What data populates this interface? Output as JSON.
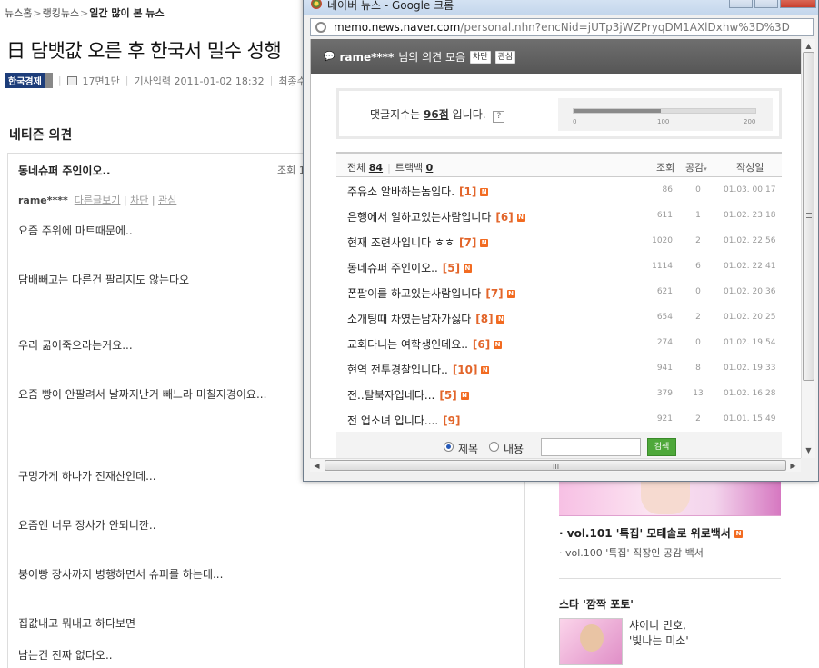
{
  "article": {
    "breadcrumb": [
      "뉴스홈",
      "랭킹뉴스",
      "일간 많이 본 뉴스"
    ],
    "headline": "日 담뱃값 오른 후 한국서 밀수 성행",
    "press": "한국경제",
    "page": "17면1단",
    "published": "기사입력 2011-01-02 18:32",
    "updated": "최종수정"
  },
  "comments": {
    "section_title": "네티즌 의견",
    "title": "동네슈퍼 주인이오..",
    "views_label": "조회 1",
    "user": "rame****",
    "actions": [
      "다른글보기",
      "차단",
      "관심"
    ],
    "lines": [
      "요즘 주위에 마트때문에..",
      "담배빼고는 다른건 팔리지도 않는다오",
      "우리 굶어죽으라는거요...",
      "요즘 빵이 안팔려서 날짜지난거 빼느라 미칠지경이요...",
      "구멍가게 하나가 전재산인데...",
      "요즘엔 너무 장사가 안되니깐..",
      "붕어빵 장사까지 병행하면서 슈퍼를 하는데...",
      "집값내고 뭐내고 하다보면",
      "남는건 진짜 없다오.."
    ]
  },
  "sidebar": {
    "item1": "vol.101 '특집' 모태솔로 위로백서",
    "item2": "vol.100 '특집' 직장인 공감 백서",
    "star_title": "스타 '깜짝 포토'",
    "star_caption": [
      "샤이니 민호,",
      "'빛나는 미소'"
    ]
  },
  "popup": {
    "window_title": "네이버 뉴스 - Google 크롬",
    "url_host": "memo.news.naver.com",
    "url_path": "/personal.nhn?encNid=jUTp3jWZPryqDM1AXlDxhw%3D%3D",
    "memo_user": "rame****",
    "memo_title_suffix": "님의 의견 모음",
    "tag_block": "차단",
    "tag_follow": "관심",
    "score_prefix": "댓글지수는",
    "score_value": "96점",
    "score_suffix": "입니다.",
    "help": "?",
    "gauge": {
      "fraction": 0.48,
      "ticks": [
        "0",
        "100",
        "200"
      ]
    },
    "tab_all_label": "전체",
    "tab_all_count": "84",
    "tab_tb_label": "트랙백",
    "tab_tb_count": "0",
    "col_views": "조회",
    "col_likes": "공감",
    "col_date": "작성일",
    "rows": [
      {
        "title": "주유소 알바하는놈임다.",
        "count": "[1]",
        "views": "86",
        "likes": "0",
        "date": "01.03. 00:17",
        "new": true
      },
      {
        "title": "은행에서 일하고있는사람입니다",
        "count": "[6]",
        "views": "611",
        "likes": "1",
        "date": "01.02. 23:18",
        "new": true
      },
      {
        "title": "현재 조련사입니다 ㅎㅎ",
        "count": "[7]",
        "views": "1020",
        "likes": "2",
        "date": "01.02. 22:56",
        "new": true
      },
      {
        "title": "동네슈퍼 주인이오..",
        "count": "[5]",
        "views": "1114",
        "likes": "6",
        "date": "01.02. 22:41",
        "new": true
      },
      {
        "title": "폰팔이를 하고있는사람입니다",
        "count": "[7]",
        "views": "621",
        "likes": "0",
        "date": "01.02. 20:36",
        "new": true
      },
      {
        "title": "소개팅때 차였는남자가싫다",
        "count": "[8]",
        "views": "654",
        "likes": "2",
        "date": "01.02. 20:25",
        "new": true
      },
      {
        "title": "교회다니는 여학생인데요..",
        "count": "[6]",
        "views": "274",
        "likes": "0",
        "date": "01.02. 19:54",
        "new": true
      },
      {
        "title": "현역 전투경찰입니다..",
        "count": "[10]",
        "views": "941",
        "likes": "8",
        "date": "01.02. 19:33",
        "new": true
      },
      {
        "title": "전..탈북자입네다...",
        "count": "[5]",
        "views": "379",
        "likes": "13",
        "date": "01.02. 16:28",
        "new": true
      },
      {
        "title": "전 업소녀 입니다....",
        "count": "[9]",
        "views": "921",
        "likes": "2",
        "date": "01.01. 15:49",
        "new": false
      }
    ],
    "search_opt_title": "제목",
    "search_opt_content": "내용",
    "search_button": "검색"
  },
  "icons": {
    "new_badge": "N",
    "scroll_up": "▲",
    "scroll_down": "▼",
    "scroll_left": "◀",
    "scroll_right": "▶",
    "grip": "III"
  }
}
